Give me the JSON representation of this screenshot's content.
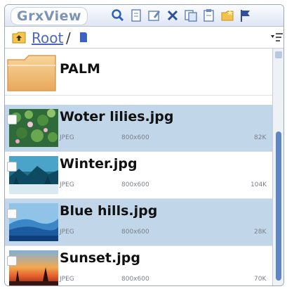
{
  "app": {
    "title": "GrxView"
  },
  "toolbar": {
    "icons": [
      "search-icon",
      "document-icon",
      "edit-icon",
      "delete-icon",
      "copy-icon",
      "paste-icon",
      "folder-icon",
      "flag-icon"
    ]
  },
  "pathbar": {
    "root_label": "Root",
    "separator": "/"
  },
  "list": {
    "folder": {
      "name": "PALM"
    },
    "files": [
      {
        "name": "Woter lilies.jpg",
        "type": "JPEG",
        "dims": "800x600",
        "size": "82K",
        "selected": true
      },
      {
        "name": "Winter.jpg",
        "type": "JPEG",
        "dims": "800x600",
        "size": "104K",
        "selected": false
      },
      {
        "name": "Blue hills.jpg",
        "type": "JPEG",
        "dims": "800x600",
        "size": "28K",
        "selected": true
      },
      {
        "name": "Sunset.jpg",
        "type": "JPEG",
        "dims": "800x600",
        "size": "70K",
        "selected": false
      }
    ]
  },
  "colors": {
    "selection": "#c2d6ea",
    "accent": "#4e67c5",
    "scroll_thumb": "#5e86c4"
  }
}
